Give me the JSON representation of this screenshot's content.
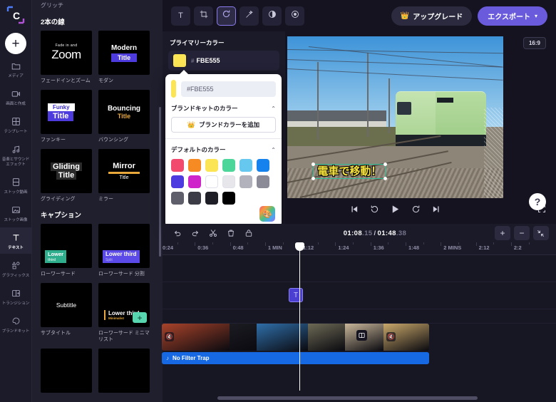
{
  "app": {
    "name": "video-editor",
    "logo_letter": "C"
  },
  "rail": {
    "add_label": "+",
    "items": [
      {
        "label": "メディア",
        "icon": "folder-icon",
        "active": false
      },
      {
        "label": "画面と作成",
        "icon": "record-icon",
        "active": false
      },
      {
        "label": "テンプレート",
        "icon": "grid-icon",
        "active": false
      },
      {
        "label": "音楽とサウンド\nエフェクト",
        "icon": "music-icon",
        "active": false
      },
      {
        "label": "ストック動画",
        "icon": "film-icon",
        "active": false
      },
      {
        "label": "ストック画像",
        "icon": "image-icon",
        "active": false
      },
      {
        "label": "テキスト",
        "icon": "text-icon",
        "active": true
      },
      {
        "label": "グラフィックス",
        "icon": "shapes-icon",
        "active": false
      },
      {
        "label": "トランジション",
        "icon": "transition-icon",
        "active": false
      },
      {
        "label": "ブランドキット",
        "icon": "brandkit-icon",
        "active": false
      }
    ]
  },
  "browser": {
    "prev_section": "グリッチ",
    "sections": [
      {
        "title": "2本の線",
        "cards": [
          {
            "caption": "フェードインとズーム",
            "style": "fade-zoom",
            "line1": "Fade in and",
            "line2": "Zoom"
          },
          {
            "caption": "モダン",
            "style": "modern",
            "line1": "Modern",
            "line2": "Title"
          },
          {
            "caption": "ファンキー",
            "style": "funky",
            "line1": "Funky",
            "line2": "Title"
          },
          {
            "caption": "バウンシング",
            "style": "bouncing",
            "line1": "Bouncing",
            "line2": "Title"
          },
          {
            "caption": "グライディング",
            "style": "gliding",
            "line1": "Gliding",
            "line2": "Title"
          },
          {
            "caption": "ミラー",
            "style": "mirror",
            "line1": "Mirror",
            "line2": "Title"
          }
        ]
      },
      {
        "title": "キャプション",
        "cards": [
          {
            "caption": "ローワーサード",
            "style": "lower",
            "line1": "Lower",
            "line2": "third"
          },
          {
            "caption": "ローワーサード 分割",
            "style": "lower3split",
            "line1": "Lower third",
            "line2": "Split"
          },
          {
            "caption": "サブタイトル",
            "style": "subtitle",
            "line1": "Subtitle",
            "line2": ""
          },
          {
            "caption": "ローワーサード ミニマリスト",
            "style": "minimalist",
            "line1": "Lower third",
            "line2": "Minimalist",
            "badge": "+"
          }
        ]
      }
    ]
  },
  "toolbar": {
    "tools": [
      {
        "name": "text-tool",
        "glyph": "T",
        "selected": false
      },
      {
        "name": "crop-tool",
        "glyph": "crop",
        "selected": false
      },
      {
        "name": "animate-tool",
        "glyph": "animate",
        "selected": true
      },
      {
        "name": "effects-tool",
        "glyph": "effects",
        "selected": false
      },
      {
        "name": "adjust-tool",
        "glyph": "contrast",
        "selected": false
      },
      {
        "name": "opacity-tool",
        "glyph": "opacity",
        "selected": false
      }
    ],
    "upgrade_label": "アップグレード",
    "export_label": "エクスポート"
  },
  "properties": {
    "primary_color_title": "プライマリーカラー",
    "primary_hex": "FBE555",
    "primary_swatch": "#FBE555"
  },
  "picker": {
    "input_value": "#FBE555",
    "input_placeholder": "#FBE555",
    "swatch": "#FBE555",
    "brandkit_title": "ブランドキットのカラー",
    "add_brand_label": "ブランドカラーを追加",
    "default_title": "デフォルトのカラー",
    "default_colors": [
      "#F24A6E",
      "#F68B24",
      "#FBE555",
      "#4DD69A",
      "#66C8EE",
      "#1682EE",
      "#4E3BE0",
      "#CE24C9",
      "#FFFFFF",
      "#E6E6EB",
      "#B2B2BC",
      "#8B8B97",
      "#5F5F6B",
      "#3C3C46",
      "#1E1E26",
      "#000000"
    ]
  },
  "preview": {
    "ratio_label": "16:9",
    "caption_text": "電車で移動！",
    "caption_color": "#F6E23C",
    "controls": [
      {
        "name": "skip-start-button",
        "glyph": "skip-back"
      },
      {
        "name": "rewind-5-button",
        "glyph": "rewind"
      },
      {
        "name": "play-button",
        "glyph": "play"
      },
      {
        "name": "forward-5-button",
        "glyph": "forward"
      },
      {
        "name": "skip-end-button",
        "glyph": "skip-forward"
      }
    ],
    "help_label": "?"
  },
  "timeline": {
    "actions": [
      {
        "name": "undo-button",
        "glyph": "↺"
      },
      {
        "name": "redo-button",
        "glyph": "↻"
      },
      {
        "name": "split-button",
        "glyph": "scissors"
      },
      {
        "name": "delete-button",
        "glyph": "trash"
      },
      {
        "name": "lock-button",
        "glyph": "lock"
      }
    ],
    "current_time": "01:08",
    "current_frames": ".15",
    "total_time": "01:48",
    "total_frames": ".38",
    "zoom_in_label": "+",
    "zoom_out_label": "−",
    "fit_label": "fit",
    "ruler_ticks": [
      "0:24",
      "0:36",
      "0:48",
      "1 MIN",
      "1:12",
      "1:24",
      "1:36",
      "1:48",
      "2 MINS",
      "2:12",
      "2:2"
    ],
    "text_clip_glyph": "T",
    "audio_clip_label": "No Filter Trap",
    "video_segments": [
      {
        "name": "clip-shrine",
        "color": "#a8432a",
        "muted": true,
        "width": 95
      },
      {
        "name": "clip-street",
        "color": "#1b1b22",
        "muted": false,
        "width": 38
      },
      {
        "name": "clip-market",
        "color": "#2f6ea8",
        "muted": false,
        "width": 72
      },
      {
        "name": "clip-track",
        "color": "#6d6a55",
        "muted": false,
        "width": 52
      },
      {
        "name": "clip-portrait",
        "color": "#c9b79a",
        "muted": false,
        "width": 54
      },
      {
        "name": "clip-sky",
        "color": "#c9a86a",
        "muted": true,
        "width": 64
      }
    ]
  }
}
